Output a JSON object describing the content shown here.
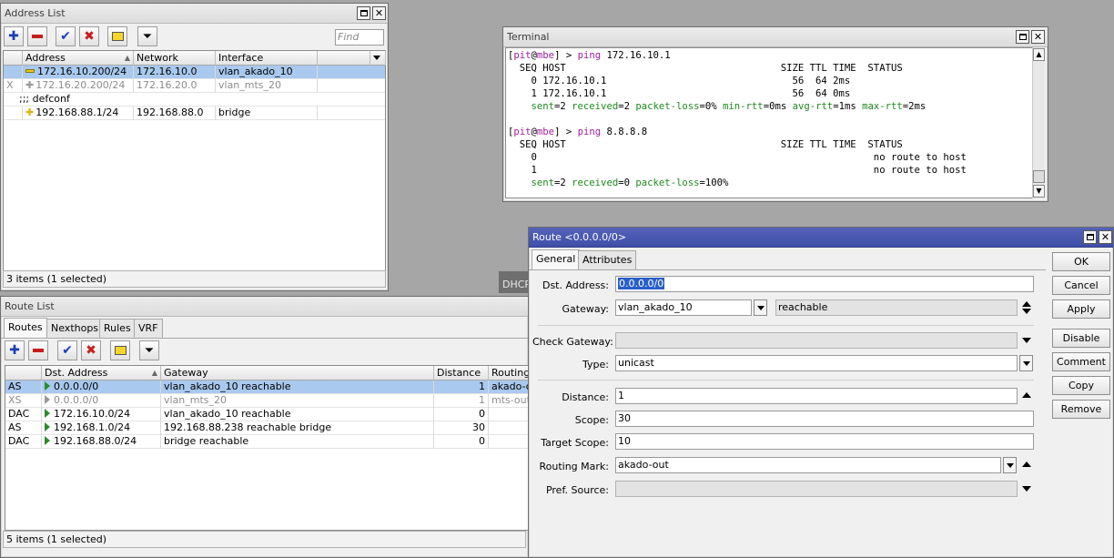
{
  "address_list": {
    "title": "Address List",
    "find_placeholder": "Find",
    "columns": [
      "Address",
      "Network",
      "Interface"
    ],
    "rows": [
      {
        "flag": "",
        "address": "172.16.10.200/24",
        "network": "172.16.10.0",
        "interface": "vlan_akado_10",
        "selected": true,
        "disabled": false
      },
      {
        "flag": "X",
        "address": "172.16.20.200/24",
        "network": "172.16.20.0",
        "interface": "vlan_mts_20",
        "selected": false,
        "disabled": true
      },
      {
        "comment": ";;; defconf"
      },
      {
        "flag": "",
        "address": "192.168.88.1/24",
        "network": "192.168.88.0",
        "interface": "bridge",
        "selected": false,
        "disabled": false
      }
    ],
    "status": "3 items (1 selected)"
  },
  "terminal": {
    "title": "Terminal",
    "lines": [
      [
        {
          "c": "pb",
          "t": "["
        },
        {
          "c": "pm",
          "t": "pit"
        },
        {
          "c": "p",
          "t": "@"
        },
        {
          "c": "pm",
          "t": "mbe"
        },
        {
          "c": "pb",
          "t": "] > "
        },
        {
          "c": "pm",
          "t": "ping"
        },
        {
          "c": "p",
          "t": " 172.16.10.1"
        }
      ],
      [
        {
          "c": "p",
          "t": "  SEQ HOST                                     SIZE TTL TIME  STATUS"
        }
      ],
      [
        {
          "c": "p",
          "t": "    0 172.16.10.1                                56  64 2ms"
        }
      ],
      [
        {
          "c": "p",
          "t": "    1 172.16.10.1                                56  64 0ms"
        }
      ],
      [
        {
          "c": "pg",
          "t": "    sent"
        },
        {
          "c": "p",
          "t": "=2 "
        },
        {
          "c": "pg",
          "t": "received"
        },
        {
          "c": "p",
          "t": "=2 "
        },
        {
          "c": "pg",
          "t": "packet-loss"
        },
        {
          "c": "p",
          "t": "=0% "
        },
        {
          "c": "pg",
          "t": "min-rtt"
        },
        {
          "c": "p",
          "t": "=0ms "
        },
        {
          "c": "pg",
          "t": "avg-rtt"
        },
        {
          "c": "p",
          "t": "=1ms "
        },
        {
          "c": "pg",
          "t": "max-rtt"
        },
        {
          "c": "p",
          "t": "=2ms"
        }
      ],
      [
        {
          "c": "p",
          "t": ""
        }
      ],
      [
        {
          "c": "pb",
          "t": "["
        },
        {
          "c": "pm",
          "t": "pit"
        },
        {
          "c": "p",
          "t": "@"
        },
        {
          "c": "pm",
          "t": "mbe"
        },
        {
          "c": "pb",
          "t": "] > "
        },
        {
          "c": "pm",
          "t": "ping"
        },
        {
          "c": "p",
          "t": " 8.8.8.8"
        }
      ],
      [
        {
          "c": "p",
          "t": "  SEQ HOST                                     SIZE TTL TIME  STATUS"
        }
      ],
      [
        {
          "c": "p",
          "t": "    0                                                          no route to host"
        }
      ],
      [
        {
          "c": "p",
          "t": "    1                                                          no route to host"
        }
      ],
      [
        {
          "c": "pg",
          "t": "    sent"
        },
        {
          "c": "p",
          "t": "=2 "
        },
        {
          "c": "pg",
          "t": "received"
        },
        {
          "c": "p",
          "t": "=0 "
        },
        {
          "c": "pg",
          "t": "packet-loss"
        },
        {
          "c": "p",
          "t": "=100%"
        }
      ]
    ]
  },
  "route_list": {
    "title": "Route List",
    "tabs": [
      "Routes",
      "Nexthops",
      "Rules",
      "VRF"
    ],
    "columns": [
      "Dst. Address",
      "Gateway",
      "Distance",
      "Routing M"
    ],
    "rows": [
      {
        "flags": "AS",
        "dst": "0.0.0.0/0",
        "gateway": "vlan_akado_10 reachable",
        "distance": "1",
        "mark": "akado-out",
        "selected": true,
        "disabled": false
      },
      {
        "flags": "XS",
        "dst": "0.0.0.0/0",
        "gateway": "vlan_mts_20",
        "distance": "1",
        "mark": "mts-out",
        "selected": false,
        "disabled": true
      },
      {
        "flags": "DAC",
        "dst": "172.16.10.0/24",
        "gateway": "vlan_akado_10 reachable",
        "distance": "0",
        "mark": "",
        "selected": false,
        "disabled": false
      },
      {
        "flags": "AS",
        "dst": "192.168.1.0/24",
        "gateway": "192.168.88.238 reachable bridge",
        "distance": "30",
        "mark": "",
        "selected": false,
        "disabled": false
      },
      {
        "flags": "DAC",
        "dst": "192.168.88.0/24",
        "gateway": "bridge reachable",
        "distance": "0",
        "mark": "",
        "selected": false,
        "disabled": false
      }
    ],
    "status": "5 items (1 selected)"
  },
  "dhcp_tab_label": "DHCP",
  "route_dialog": {
    "title": "Route <0.0.0.0/0>",
    "tabs": [
      "General",
      "Attributes"
    ],
    "labels": {
      "dst": "Dst. Address:",
      "gateway": "Gateway:",
      "check_gateway": "Check Gateway:",
      "type": "Type:",
      "distance": "Distance:",
      "scope": "Scope:",
      "target_scope": "Target Scope:",
      "routing_mark": "Routing Mark:",
      "pref_source": "Pref. Source:"
    },
    "values": {
      "dst": "0.0.0.0/0",
      "gateway": "vlan_akado_10",
      "gateway_state": "reachable",
      "check_gateway": "",
      "type": "unicast",
      "distance": "1",
      "scope": "30",
      "target_scope": "10",
      "routing_mark": "akado-out",
      "pref_source": ""
    },
    "buttons": [
      "OK",
      "Cancel",
      "Apply",
      "Disable",
      "Comment",
      "Copy",
      "Remove"
    ]
  }
}
